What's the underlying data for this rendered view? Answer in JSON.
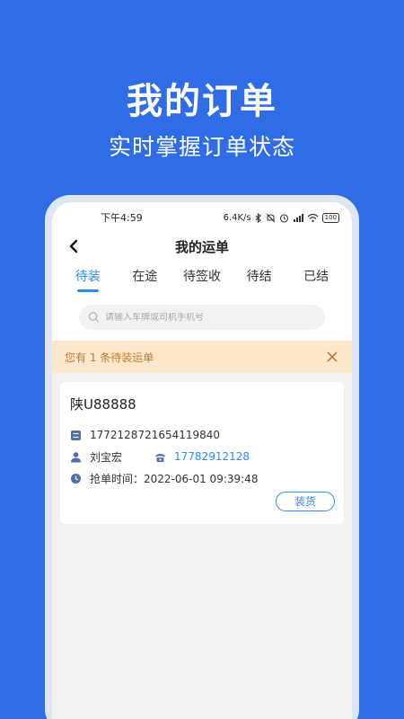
{
  "promo": {
    "title": "我的订单",
    "subtitle": "实时掌握订单状态"
  },
  "status_bar": {
    "time": "下午4:59",
    "speed": "6.4K/s",
    "battery": "100"
  },
  "header": {
    "title": "我的运单"
  },
  "tabs": [
    {
      "label": "待装",
      "active": true
    },
    {
      "label": "在途",
      "active": false
    },
    {
      "label": "待签收",
      "active": false
    },
    {
      "label": "待结",
      "active": false
    },
    {
      "label": "已结",
      "active": false
    }
  ],
  "search": {
    "placeholder": "请输入车牌或司机手机号",
    "value": ""
  },
  "notice": {
    "text": "您有 1 条待装运单"
  },
  "orders": [
    {
      "plate": "陕U88888",
      "order_no": "1772128721654119840",
      "driver": "刘宝宏",
      "phone": "17782912128",
      "grab_time": "抢单时间：2022-06-01 09:39:48",
      "action": "装货"
    }
  ],
  "colors": {
    "background": "#2f6de6",
    "accent": "#2d8cf0",
    "notice_bg": "#fde7cd",
    "notice_text": "#c27a2c"
  }
}
